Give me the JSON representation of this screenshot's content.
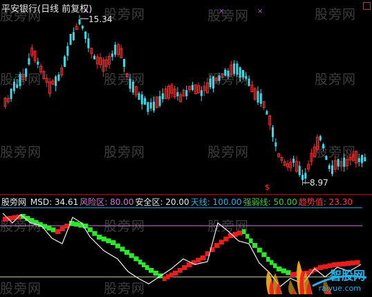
{
  "chart_title": "平安银行(日线 前复权)",
  "watermark": "股旁网",
  "price_labels": {
    "high": "15.34",
    "low": "8.97"
  },
  "bottom_marker": "$",
  "indicator": {
    "name_label": "股旁网",
    "items": [
      {
        "key": "MSD",
        "label": "MSD: ",
        "value": "34.61",
        "color": "#e8e8e8"
      },
      {
        "key": "risk",
        "label": "风险区: ",
        "value": "80.00",
        "color": "#d27ad2"
      },
      {
        "key": "safe",
        "label": "安全区: ",
        "value": "20.00",
        "color": "#e8e8e8"
      },
      {
        "key": "sky",
        "label": "天线: ",
        "value": "100.00",
        "color": "#27b0e6"
      },
      {
        "key": "strength",
        "label": "强弱线: ",
        "value": "50.00",
        "color": "#3ccc3c"
      },
      {
        "key": "trend",
        "label": "趋势值: ",
        "value": "23.30",
        "color": "#ff3b3b"
      }
    ]
  },
  "logo": {
    "text": "智股网",
    "url": "raiyue.com"
  },
  "colors": {
    "up": "#e83030",
    "down": "#3fd6e6",
    "background": "#000000"
  }
}
